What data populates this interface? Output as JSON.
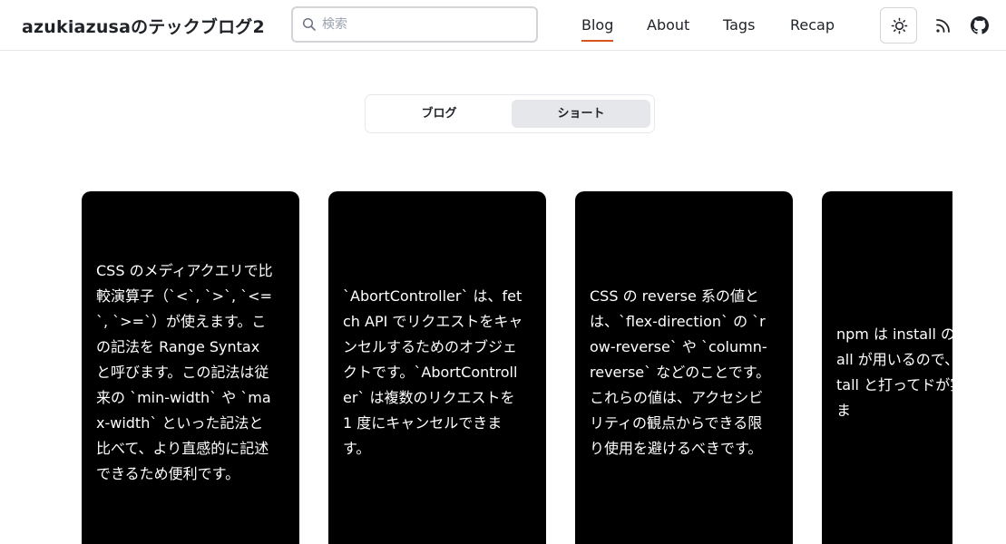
{
  "header": {
    "site_title": "azukiazusaのテックブログ2",
    "search_placeholder": "検索",
    "nav": [
      {
        "label": "Blog",
        "active": true
      },
      {
        "label": "About",
        "active": false
      },
      {
        "label": "Tags",
        "active": false
      },
      {
        "label": "Recap",
        "active": false
      }
    ],
    "icons": [
      "sun-icon",
      "rss-icon",
      "github-icon"
    ],
    "accent_color": "#d9531e"
  },
  "toggle": {
    "options": [
      {
        "label": "ブログ",
        "selected": false
      },
      {
        "label": "ショート",
        "selected": true
      }
    ]
  },
  "cards": [
    {
      "text": "CSS のメディアクエリで比較演算子（`<`, `>`, `<=`, `>=`）が使えます。この記法を Range Syntax と呼びます。この記法は従来の `min-width` や `max-width` といった記法と比べて、より直感的に記述できるため便利です。"
    },
    {
      "text": "`AbortController` は、fetch API でリクエストをキャンセルするためのオブジェクトです。`AbortController` は複数のリクエストを 1 度にキャンセルできます。"
    },
    {
      "text": "CSS の reverse 系の値とは、`flex-direction` の `row-reverse` や `column-reverse` などのことです。これらの値は、アクセシビリティの観点からできる限り使用を避けるべきです。"
    },
    {
      "text": "npm は install のして isntall が用いるので、typo isntall と打ってドが実行されま"
    }
  ]
}
